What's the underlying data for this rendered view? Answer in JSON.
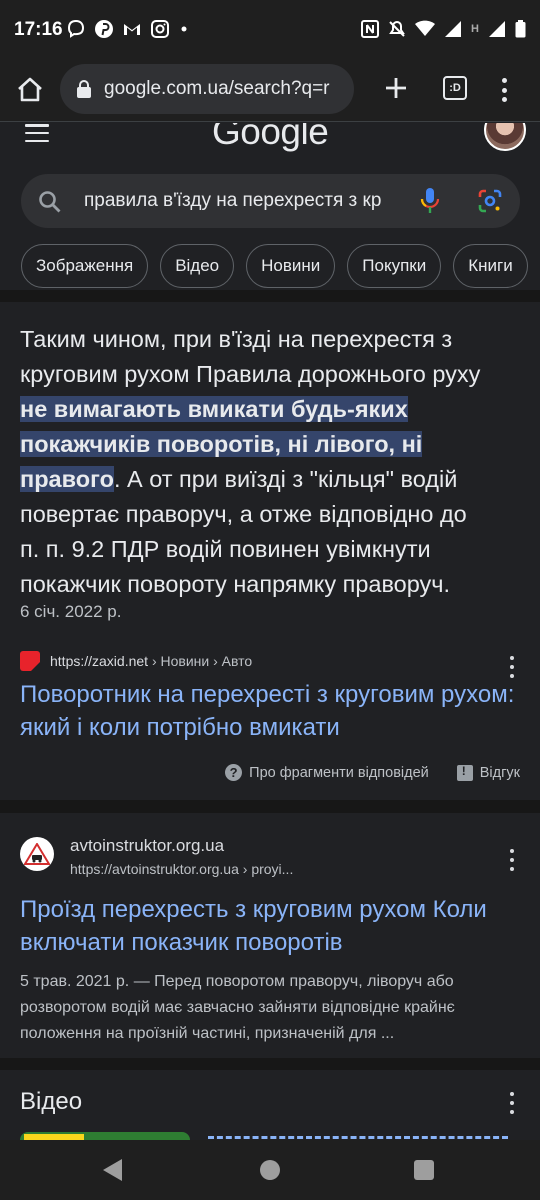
{
  "status_bar": {
    "time": "17:16",
    "left_icons": [
      "viber-icon",
      "pinterest-icon",
      "gmail-icon",
      "instagram-icon",
      "dot-icon"
    ],
    "right_icons": [
      "nfc-icon",
      "mute-icon",
      "wifi-icon",
      "signal-icon",
      "signal-h-icon",
      "battery-icon"
    ],
    "network_label": "H"
  },
  "browser": {
    "url": "google.com.ua/search?q=r",
    "tabs_label": ":D"
  },
  "google": {
    "logo_text": "Google",
    "search_query": "правила в'їзду на перехрестя з кр"
  },
  "chips": [
    "Зображення",
    "Відео",
    "Новини",
    "Покупки",
    "Книги"
  ],
  "featured_snippet": {
    "text_before": "Таким чином, при в'їзді на перехрестя з круговим рухом Правила дорожнього руху ",
    "text_highlight": "не вимагають вмикати будь-яких покажчиків поворотів, ні лівого, ні правого",
    "text_after": ". А от при виїзді з \"кільця\" водій повертає праворуч, а отже відповідно до п. п. 9.2 ПДР водій повинен увімкнути покажчик повороту напрямку праворуч.",
    "date": "6 січ. 2022 р.",
    "source_url": "https://zaxid.net",
    "source_path": " › Новини › Авто",
    "title": "Поворотник на перехресті з круговим рухом: який і коли потрібно вмикати",
    "about_label": "Про фрагменти відповідей",
    "feedback_label": "Відгук"
  },
  "result2": {
    "site_name": "avtoinstruktor.org.ua",
    "site_url": "https://avtoinstruktor.org.ua",
    "site_path": " › proyi...",
    "title": "Проїзд перехресть з круговим рухом Коли включати показчик поворотів",
    "description": "5 трав. 2021 р. — Перед поворотом праворуч, ліворуч або розворотом водій має завчасно зайняти відповідне крайнє положення на проїзній частині, призначеній для ..."
  },
  "videos": {
    "title": "Відео"
  },
  "colors": {
    "background": "#202124",
    "link": "#8ab4f8",
    "highlight": "#35456b",
    "zaxid_red": "#e8232b"
  }
}
